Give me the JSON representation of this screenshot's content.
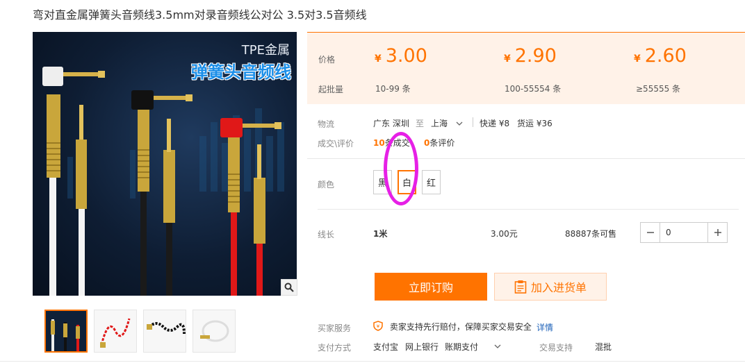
{
  "page": {
    "title": "弯对直金属弹簧头音频线3.5mm对录音频线公对公 3.5对3.5音频线"
  },
  "gallery": {
    "brand_top": "TPE金属",
    "brand_main": "弹簧头音频线"
  },
  "price_panel": {
    "price_label": "价格",
    "moq_label": "起批量",
    "tiers": [
      {
        "currency": "¥",
        "price": "3.00",
        "qty": "10-99 条"
      },
      {
        "currency": "¥",
        "price": "2.90",
        "qty": "100-55554 条"
      },
      {
        "currency": "¥",
        "price": "2.60",
        "qty": "≥55555 条"
      }
    ]
  },
  "logistics": {
    "label": "物流",
    "from": "广东 深圳",
    "to_word": "至",
    "to": "上海",
    "express": "快递 ¥8",
    "freight": "货运 ¥36"
  },
  "deals": {
    "label": "成交\\评价",
    "count": "10",
    "count_suffix": "条成交",
    "reviews": "0",
    "reviews_suffix": "条评价"
  },
  "color": {
    "label": "颜色",
    "options": [
      "黑",
      "白",
      "红"
    ],
    "selected": "白",
    "selected_color": "#ff7300"
  },
  "length": {
    "label": "线长",
    "value": "1米",
    "price": "3.00元",
    "stock": "88887条可售",
    "quantity": "0"
  },
  "actions": {
    "buy_now": "立即订购",
    "add_to_cart": "加入进货单"
  },
  "service": {
    "label": "买家服务",
    "text": "卖家支持先行赔付，保障买家交易安全",
    "link": "详情"
  },
  "payment": {
    "label": "支付方式",
    "methods": [
      "支付宝",
      "网上银行",
      "账期支付"
    ],
    "trade_label": "交易支持",
    "trade_value": "混批"
  },
  "colors": {
    "accent": "#ff7300",
    "panel_bg": "#fff2e8",
    "annotation": "#e620e6"
  }
}
